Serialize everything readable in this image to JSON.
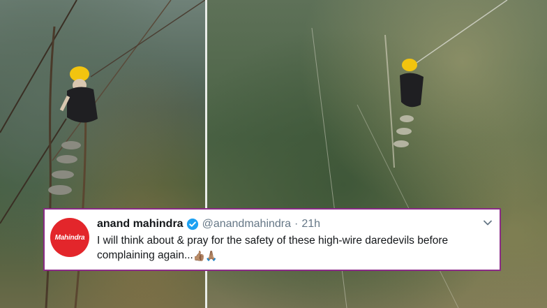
{
  "tweet": {
    "avatar_text": "Mahindra",
    "author_name": "anand mahindra",
    "handle": "@anandmahindra",
    "separator": "·",
    "time": "21h",
    "text_line1": "I will think about & pray for the safety of these high-wire daredevils before",
    "text_line2": "complaining again...",
    "emoji_1": "👍🏽",
    "emoji_2": "🙏🏽"
  },
  "colors": {
    "card_border": "#8a2a86",
    "avatar_bg": "#e3262b",
    "verified": "#1da1f2"
  },
  "icons": {
    "verified": "verified-badge-icon",
    "menu": "chevron-down-icon"
  }
}
